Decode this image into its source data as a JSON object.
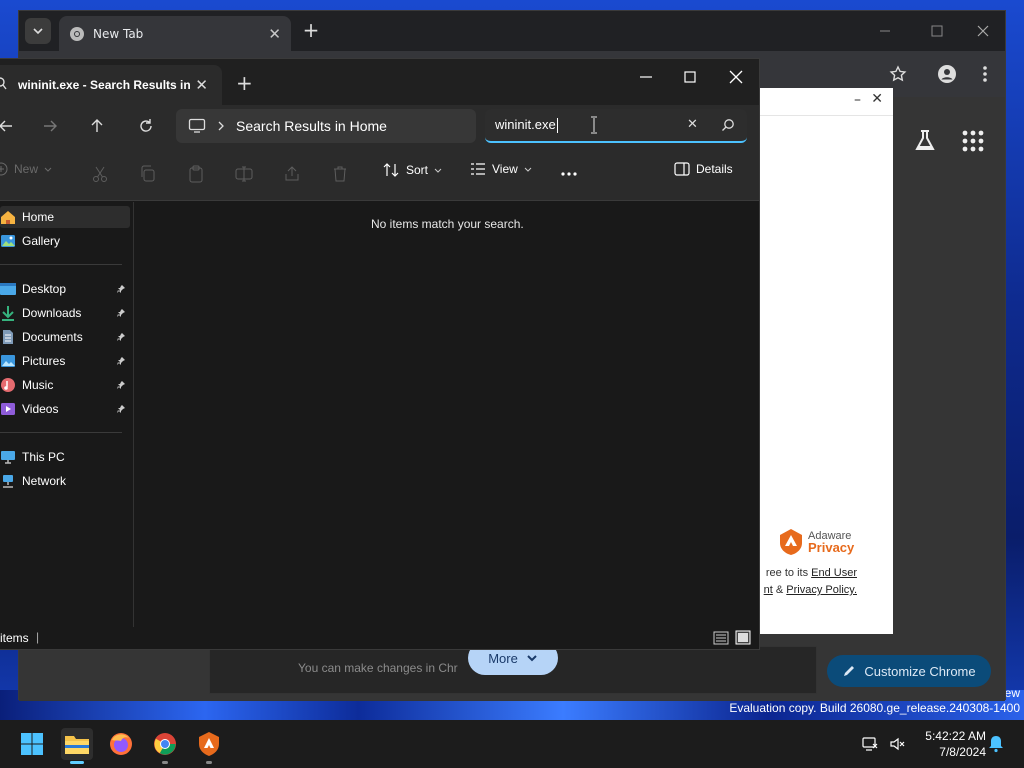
{
  "desktop": {
    "watermark_line1": "ew",
    "watermark_line2": "Evaluation copy. Build 26080.ge_release.240308-1400"
  },
  "chrome": {
    "tab_title": "New Tab",
    "banner_text": "You can make changes in Chr",
    "more_label": "More",
    "customize_label": "Customize Chrome"
  },
  "adaware": {
    "brand_line1": "Adaware",
    "brand_line2": "Privacy",
    "legal_line1_prefix": "ree to its ",
    "legal_line1_link": "End User",
    "legal_line2_link1": "nt",
    "legal_line2_amp": " & ",
    "legal_line2_link2": "Privacy Policy."
  },
  "explorer": {
    "tab_title": "wininit.exe - Search Results in",
    "address": "Search Results in Home",
    "search_value": "wininit.exe",
    "commands": {
      "new": "New",
      "sort": "Sort",
      "view": "View",
      "details": "Details"
    },
    "nav": {
      "home": "Home",
      "gallery": "Gallery",
      "desktop": "Desktop",
      "downloads": "Downloads",
      "documents": "Documents",
      "pictures": "Pictures",
      "music": "Music",
      "videos": "Videos",
      "this_pc": "This PC",
      "network": "Network"
    },
    "empty_message": "No items match your search.",
    "status_text": "items"
  },
  "taskbar": {
    "time": "5:42:22 AM",
    "date": "7/8/2024"
  },
  "colors": {
    "accent": "#4cc2ff",
    "adaware_orange": "#e76a1c",
    "customize_bg": "#0b4b79",
    "more_bg": "#b6d4f7"
  }
}
